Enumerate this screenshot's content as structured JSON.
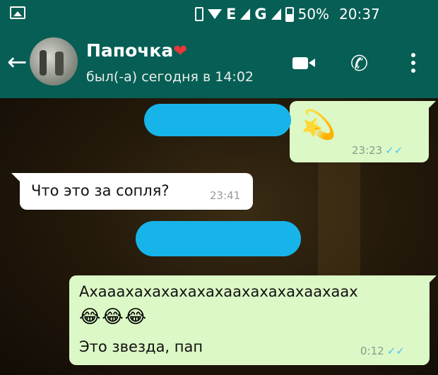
{
  "status_bar": {
    "network_1": "E",
    "network_2": "G",
    "battery": "50%",
    "time": "20:37",
    "icons": [
      "gallery-icon",
      "vibrate-icon",
      "wifi-icon",
      "signal-icon",
      "battery-icon"
    ]
  },
  "header": {
    "back_icon": "←",
    "contact_name": "Папочка",
    "contact_emoji": "❤",
    "last_seen": "был(-а) сегодня в 14:02",
    "icons": [
      "video-call-icon",
      "phone-icon",
      "more-options-icon"
    ],
    "color": "#075e54"
  },
  "chat": {
    "messages": [
      {
        "direction": "out",
        "content": "💫",
        "time": "23:23",
        "ticks": "✓✓",
        "has_redacted_text": true
      },
      {
        "direction": "in",
        "text": "Что это за сопля?",
        "time": "23:41"
      },
      {
        "direction": "out",
        "line1": "Ахааахахахахахахаахахахахаахаах",
        "emoji": "😂😂😂",
        "line3": "Это звезда, пап",
        "time": "0:12",
        "ticks": "✓✓",
        "has_redacted_text": true
      }
    ],
    "colors": {
      "outgoing_bubble": "#dcf8c6",
      "incoming_bubble": "#ffffff",
      "read_ticks": "#4fc3f7",
      "redaction": "#17b4e9"
    }
  }
}
